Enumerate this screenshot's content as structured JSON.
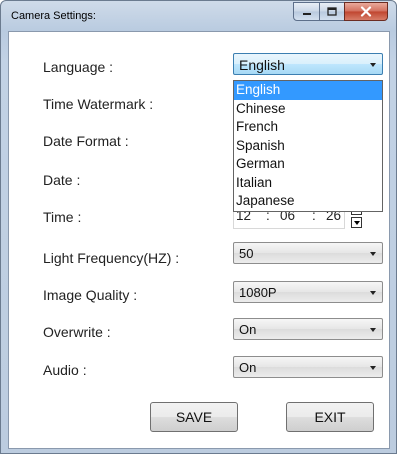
{
  "window": {
    "title": "Camera Settings:"
  },
  "fields": {
    "language": {
      "label": "Language :",
      "value": "English"
    },
    "watermark": {
      "label": "Time Watermark :"
    },
    "date_format": {
      "label": "Date Format :"
    },
    "date": {
      "label": "Date :"
    },
    "time": {
      "label": "Time :",
      "hour": "12",
      "minute": "06",
      "second": "26",
      "sep": ":"
    },
    "light_frequency": {
      "label": "Light Frequency(HZ) :",
      "value": "50"
    },
    "image_quality": {
      "label": "Image Quality :",
      "value": "1080P"
    },
    "overwrite": {
      "label": "Overwrite :",
      "value": "On"
    },
    "audio": {
      "label": "Audio :",
      "value": "On"
    }
  },
  "language_options": [
    "English",
    "Chinese",
    "French",
    "Spanish",
    "German",
    "Italian",
    "Japanese"
  ],
  "language_selected_index": 0,
  "buttons": {
    "save": "SAVE",
    "exit": "EXIT"
  },
  "icons": {
    "minimize": "minimize-icon",
    "maximize": "maximize-icon",
    "close": "close-icon",
    "dropdown": "chevron-down-icon",
    "spin_up": "spin-up-icon",
    "spin_down": "spin-down-icon"
  },
  "colors": {
    "selection": "#3399ff",
    "close_button": "#c0452f",
    "title_bar": "#b9cbe0"
  }
}
